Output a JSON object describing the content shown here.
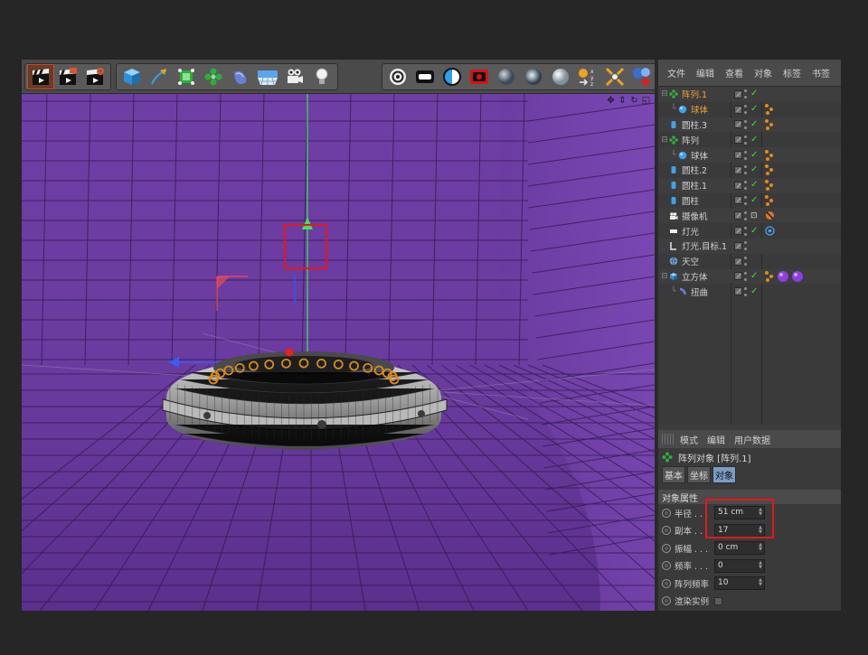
{
  "colors": {
    "highlight": "#e8151d",
    "accent_active_tab": "#7a9cc5",
    "viewport": "#6a3b9e",
    "check": "#4cd24c"
  },
  "toolbar": {
    "icons": [
      "clapboard-icon",
      "render-to-picture-viewer-icon",
      "render-settings-icon",
      "cube-icon",
      "pen-icon",
      "subdivision-icon",
      "mograph-cloner-icon",
      "deformer-icon",
      "floor-icon",
      "camera-icon",
      "light-icon",
      "target-icon",
      "rectangle-light-icon",
      "contrast-icon",
      "record-icon",
      "sphere-icon",
      "glass-sphere-icon",
      "matte-sphere-icon",
      "coordinate-system-icon",
      "axis-snap-icon",
      "drop-icon"
    ]
  },
  "object_manager": {
    "menu": [
      "文件",
      "编辑",
      "查看",
      "对象",
      "标签",
      "书签"
    ],
    "rows": [
      {
        "name": "阵列.1",
        "indent": 0,
        "tree": "⊟",
        "icon": "cloner-icon",
        "highlight": true,
        "tags": "none"
      },
      {
        "name": "球体",
        "indent": 1,
        "tree": "└",
        "icon": "sphere-icon",
        "highlight": true,
        "tags": "orange"
      },
      {
        "name": "圆柱.3",
        "indent": 0,
        "tree": "",
        "icon": "cylinder-icon",
        "highlight": false,
        "tags": "orange"
      },
      {
        "name": "阵列",
        "indent": 0,
        "tree": "⊟",
        "icon": "cloner-icon",
        "highlight": false,
        "tags": "none"
      },
      {
        "name": "球体",
        "indent": 1,
        "tree": "└",
        "icon": "sphere-icon",
        "highlight": false,
        "tags": "orange"
      },
      {
        "name": "圆柱.2",
        "indent": 0,
        "tree": "",
        "icon": "cylinder-icon",
        "highlight": false,
        "tags": "orange"
      },
      {
        "name": "圆柱.1",
        "indent": 0,
        "tree": "",
        "icon": "cylinder-icon",
        "highlight": false,
        "tags": "orange"
      },
      {
        "name": "圆柱",
        "indent": 0,
        "tree": "",
        "icon": "cylinder-icon",
        "highlight": false,
        "tags": "orange"
      },
      {
        "name": "摄像机",
        "indent": 0,
        "tree": "",
        "icon": "camera-icon",
        "highlight": false,
        "tags": "camera"
      },
      {
        "name": "灯光",
        "indent": 0,
        "tree": "",
        "icon": "light-icon",
        "highlight": false,
        "tags": "light"
      },
      {
        "name": "灯光.目标.1",
        "indent": 0,
        "tree": "",
        "icon": "target-light-icon",
        "highlight": false,
        "tags": "none"
      },
      {
        "name": "天空",
        "indent": 0,
        "tree": "",
        "icon": "sky-icon",
        "highlight": false,
        "tags": "none"
      },
      {
        "name": "立方体",
        "indent": 0,
        "tree": "⊟",
        "icon": "cube-icon",
        "highlight": false,
        "tags": "cube"
      },
      {
        "name": "扭曲",
        "indent": 1,
        "tree": "└",
        "icon": "bend-icon",
        "highlight": false,
        "tags": "none"
      }
    ]
  },
  "attribute_manager": {
    "menu": [
      "模式",
      "编辑",
      "用户数据"
    ],
    "title": "阵列对象 [阵列.1]",
    "tabs": [
      "基本",
      "坐标",
      "对象"
    ],
    "active_tab": "对象",
    "section": "对象属性",
    "fields": [
      {
        "label": "半径 . . .",
        "value": "51 cm"
      },
      {
        "label": "副本 . . .",
        "value": "17"
      },
      {
        "label": "振幅 . . .",
        "value": "0 cm"
      },
      {
        "label": "频率 . . .",
        "value": "0"
      },
      {
        "label": "阵列频率",
        "value": "10"
      }
    ],
    "checkbox_label": "渲染实例"
  }
}
